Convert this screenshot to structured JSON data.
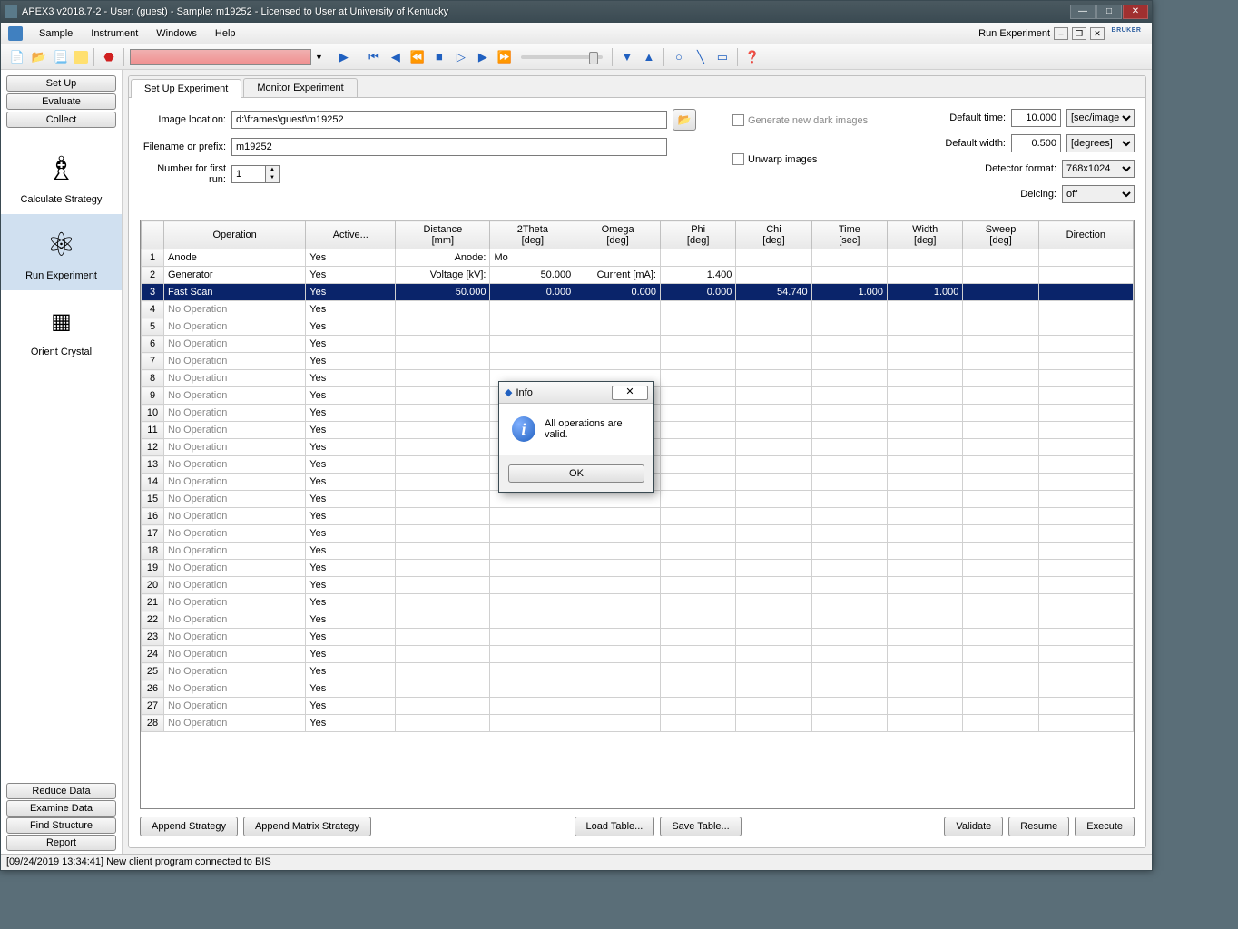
{
  "title": "APEX3 v2018.7-2 - User: (guest) - Sample: m19252 - Licensed to User at University of Kentucky",
  "menubar": {
    "run_experiment": "Run Experiment",
    "items": [
      "Sample",
      "Instrument",
      "Windows",
      "Help"
    ],
    "logo": "BRUKER"
  },
  "sidebar": {
    "top_buttons": [
      "Set Up",
      "Evaluate",
      "Collect"
    ],
    "icons": [
      {
        "label": "Calculate Strategy"
      },
      {
        "label": "Run Experiment"
      },
      {
        "label": "Orient Crystal"
      }
    ],
    "bottom_buttons": [
      "Reduce Data",
      "Examine Data",
      "Find Structure",
      "Report"
    ]
  },
  "tabs": [
    "Set Up Experiment",
    "Monitor Experiment"
  ],
  "setup": {
    "image_location_label": "Image location:",
    "image_location": "d:\\frames\\guest\\m19252",
    "filename_label": "Filename or prefix:",
    "filename": "m19252",
    "number_label": "Number for first run:",
    "number": "1",
    "gen_dark": "Generate new dark images",
    "unwarp": "Unwarp images",
    "default_time_label": "Default time:",
    "default_time": "10.000",
    "default_time_unit": "[sec/image]",
    "default_width_label": "Default width:",
    "default_width": "0.500",
    "default_width_unit": "[degrees]",
    "detector_format_label": "Detector format:",
    "detector_format": "768x1024",
    "deicing_label": "Deicing:",
    "deicing": "off"
  },
  "table": {
    "headers": [
      "",
      "Operation",
      "Active...",
      "Distance\n[mm]",
      "2Theta\n[deg]",
      "Omega\n[deg]",
      "Phi\n[deg]",
      "Chi\n[deg]",
      "Time\n[sec]",
      "Width\n[deg]",
      "Sweep\n[deg]",
      "Direction"
    ],
    "rows": [
      {
        "n": 1,
        "op": "Anode",
        "active": "Yes",
        "c3r": "Anode:",
        "c4": "Mo"
      },
      {
        "n": 2,
        "op": "Generator",
        "active": "Yes",
        "c3r": "Voltage [kV]:",
        "c4": "50.000",
        "c5r": "Current [mA]:",
        "c6": "1.400"
      },
      {
        "n": 3,
        "op": "Fast Scan",
        "active": "Yes",
        "c3": "50.000",
        "c4": "0.000",
        "c5": "0.000",
        "c6": "0.000",
        "c7": "54.740",
        "c8": "1.000",
        "c9": "1.000",
        "selected": true
      },
      {
        "n": 4,
        "op": "No Operation",
        "active": "Yes",
        "grey": true
      },
      {
        "n": 5,
        "op": "No Operation",
        "active": "Yes",
        "grey": true
      },
      {
        "n": 6,
        "op": "No Operation",
        "active": "Yes",
        "grey": true
      },
      {
        "n": 7,
        "op": "No Operation",
        "active": "Yes",
        "grey": true
      },
      {
        "n": 8,
        "op": "No Operation",
        "active": "Yes",
        "grey": true
      },
      {
        "n": 9,
        "op": "No Operation",
        "active": "Yes",
        "grey": true
      },
      {
        "n": 10,
        "op": "No Operation",
        "active": "Yes",
        "grey": true
      },
      {
        "n": 11,
        "op": "No Operation",
        "active": "Yes",
        "grey": true
      },
      {
        "n": 12,
        "op": "No Operation",
        "active": "Yes",
        "grey": true
      },
      {
        "n": 13,
        "op": "No Operation",
        "active": "Yes",
        "grey": true
      },
      {
        "n": 14,
        "op": "No Operation",
        "active": "Yes",
        "grey": true
      },
      {
        "n": 15,
        "op": "No Operation",
        "active": "Yes",
        "grey": true
      },
      {
        "n": 16,
        "op": "No Operation",
        "active": "Yes",
        "grey": true
      },
      {
        "n": 17,
        "op": "No Operation",
        "active": "Yes",
        "grey": true
      },
      {
        "n": 18,
        "op": "No Operation",
        "active": "Yes",
        "grey": true
      },
      {
        "n": 19,
        "op": "No Operation",
        "active": "Yes",
        "grey": true
      },
      {
        "n": 20,
        "op": "No Operation",
        "active": "Yes",
        "grey": true
      },
      {
        "n": 21,
        "op": "No Operation",
        "active": "Yes",
        "grey": true
      },
      {
        "n": 22,
        "op": "No Operation",
        "active": "Yes",
        "grey": true
      },
      {
        "n": 23,
        "op": "No Operation",
        "active": "Yes",
        "grey": true
      },
      {
        "n": 24,
        "op": "No Operation",
        "active": "Yes",
        "grey": true
      },
      {
        "n": 25,
        "op": "No Operation",
        "active": "Yes",
        "grey": true
      },
      {
        "n": 26,
        "op": "No Operation",
        "active": "Yes",
        "grey": true
      },
      {
        "n": 27,
        "op": "No Operation",
        "active": "Yes",
        "grey": true
      },
      {
        "n": 28,
        "op": "No Operation",
        "active": "Yes",
        "grey": true
      }
    ]
  },
  "bottom_buttons": {
    "append_strategy": "Append Strategy",
    "append_matrix": "Append Matrix Strategy",
    "load_table": "Load Table...",
    "save_table": "Save Table...",
    "validate": "Validate",
    "resume": "Resume",
    "execute": "Execute"
  },
  "statusbar": "[09/24/2019 13:34:41] New client program connected to BIS",
  "dialog": {
    "title": "Info",
    "message": "All operations are valid.",
    "ok": "OK"
  }
}
